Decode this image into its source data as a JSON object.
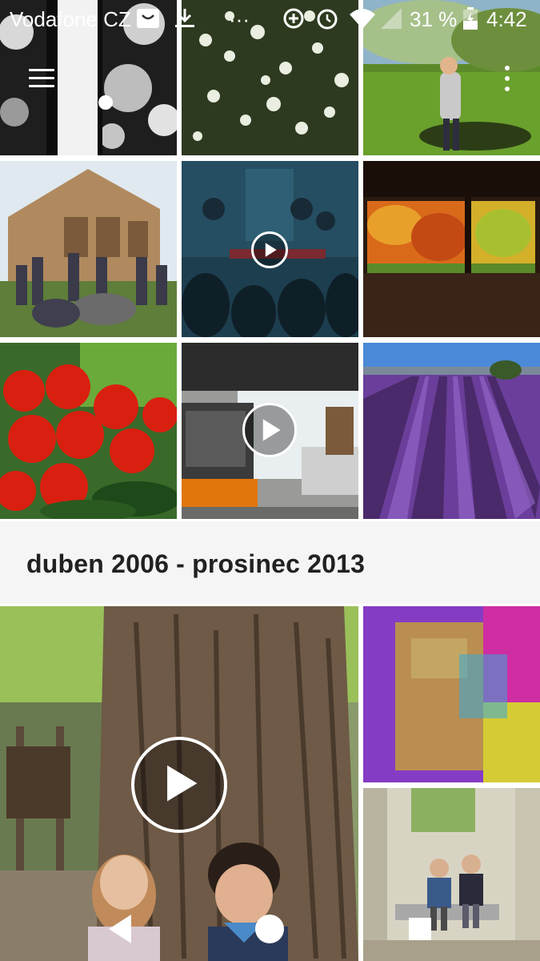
{
  "status_bar": {
    "carrier": "Vodafone CZ",
    "overflow": "···",
    "battery": "31 %",
    "time": "4:42",
    "icons": [
      "shop-notification-icon",
      "download-icon",
      "data-saver-icon",
      "alarm-icon",
      "wifi-icon",
      "signal-icon",
      "battery-icon"
    ]
  },
  "toolbar": {
    "menu_icon": "hamburger-menu-icon",
    "more_icon": "more-vert-icon"
  },
  "gallery": {
    "top_items": [
      {
        "subject": "black and white flowers",
        "type": "photo"
      },
      {
        "subject": "white blossom bush",
        "type": "photo"
      },
      {
        "subject": "child in garden",
        "type": "photo"
      },
      {
        "subject": "brick building with people",
        "type": "photo"
      },
      {
        "subject": "puppet theatre stage",
        "type": "video"
      },
      {
        "subject": "japanese room with autumn garden",
        "type": "photo"
      },
      {
        "subject": "tomatoes and cucumbers",
        "type": "photo"
      },
      {
        "subject": "orange vehicle with trailer",
        "type": "video"
      },
      {
        "subject": "lavender field",
        "type": "photo"
      }
    ],
    "section_title": "duben 2006 - prosinec 2013",
    "section_items": [
      {
        "subject": "children at tree trunk",
        "type": "video"
      },
      {
        "subject": "colorful abstract print",
        "type": "photo"
      },
      {
        "subject": "two children on bench",
        "type": "photo"
      }
    ]
  },
  "nav_bar": {
    "back_icon": "back-triangle-icon",
    "home_icon": "home-circle-icon",
    "recents_icon": "recents-square-icon"
  },
  "colors": {
    "section_background": "#f5f5f5",
    "section_text": "#212121",
    "status_text": "#ffffff"
  }
}
